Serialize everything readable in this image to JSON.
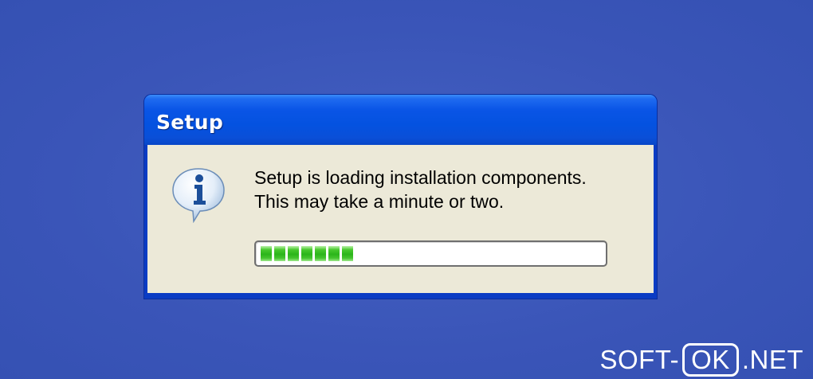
{
  "dialog": {
    "title": "Setup",
    "icon": "info-icon",
    "message_line1": "Setup is loading installation components.",
    "message_line2": "This may take a minute or two.",
    "progress": {
      "percent": 30,
      "filled_segments": 7,
      "fill_color": "#2bb51a"
    }
  },
  "watermark": {
    "prefix": "SOFT-",
    "boxed": "OK",
    "suffix": ".NET"
  },
  "colors": {
    "desktop": "#3b55b9",
    "titlebar": "#0452e0",
    "client": "#ece9d8"
  }
}
